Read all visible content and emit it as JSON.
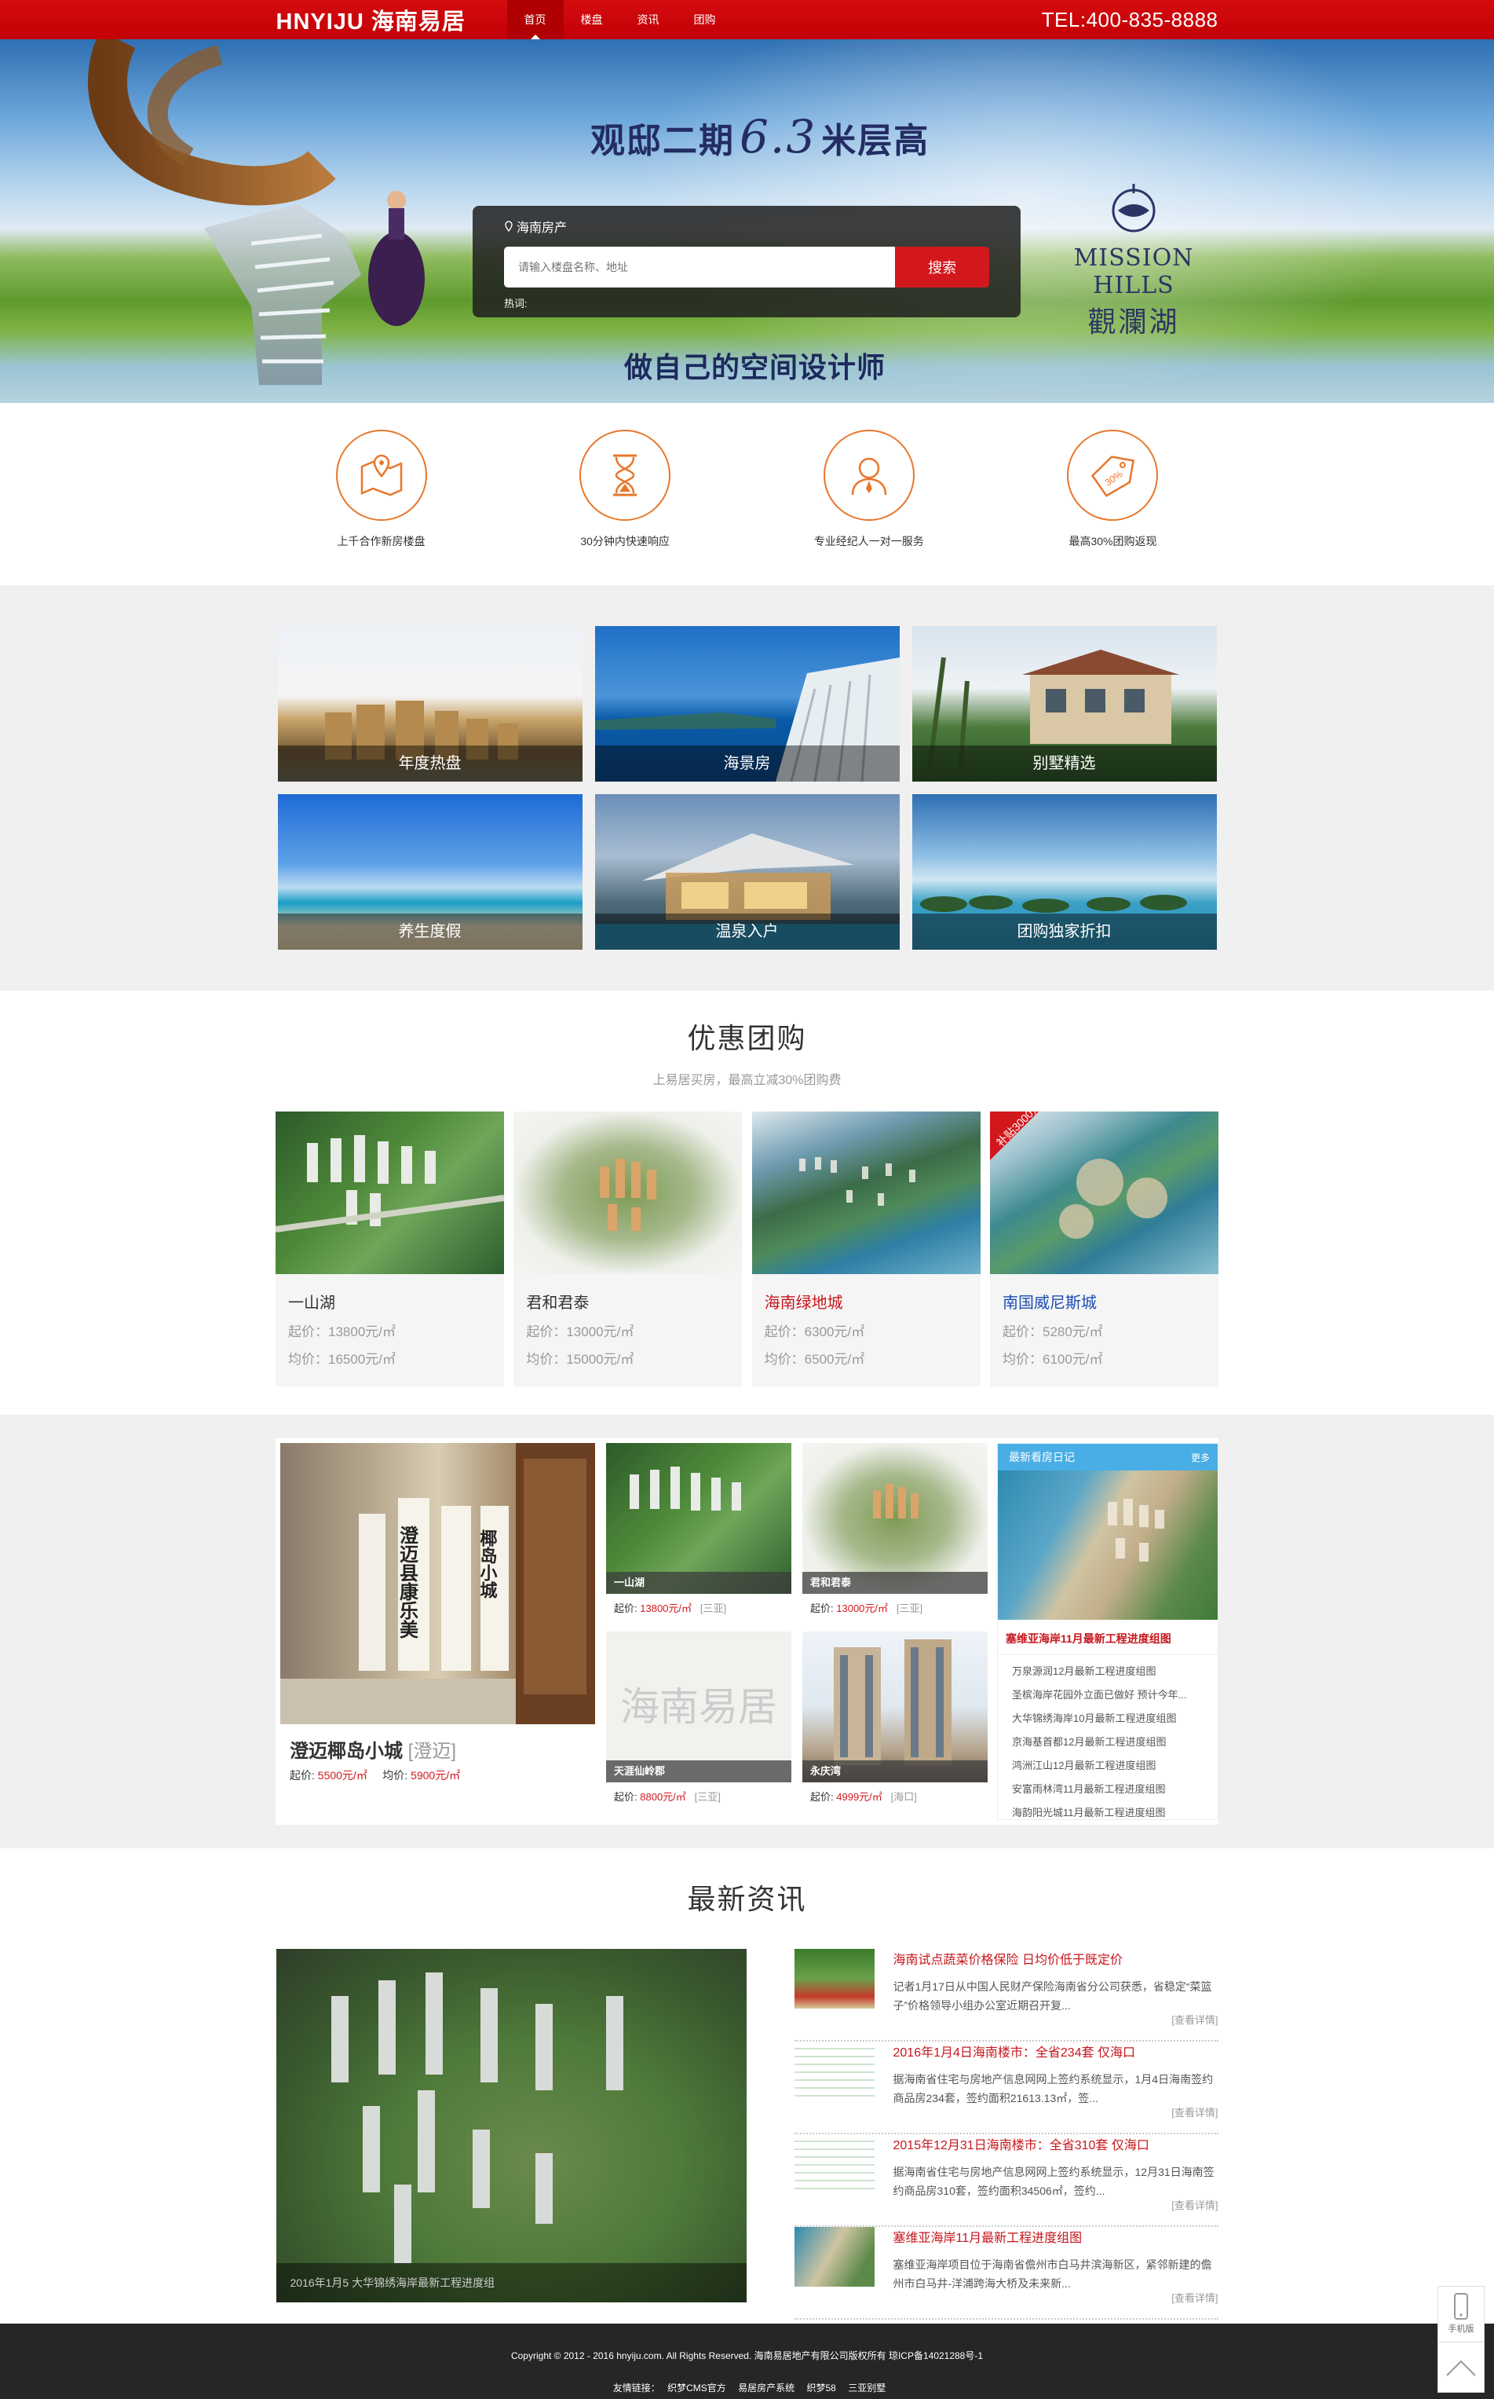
{
  "header": {
    "logo": "HNYIJU 海南易居",
    "nav": [
      {
        "label": "首页",
        "active": true
      },
      {
        "label": "楼盘",
        "active": false
      },
      {
        "label": "资讯",
        "active": false
      },
      {
        "label": "团购",
        "active": false
      }
    ],
    "tel": "TEL:400-835-8888"
  },
  "hero": {
    "title_pre": "观邸二期",
    "title_num": "6.3",
    "title_post": "米层高",
    "slogan": "做自己的空间设计师",
    "brand_en": "MISSION HILLS",
    "brand_cn": "觀瀾湖",
    "search": {
      "location": "海南房产",
      "placeholder": "请输入楼盘名称、地址",
      "button": "搜索",
      "hot_label": "热词:"
    }
  },
  "features": [
    {
      "icon": "map-pin-icon",
      "label": "上千合作新房楼盘"
    },
    {
      "icon": "hourglass-icon",
      "label": "30分钟内快速响应"
    },
    {
      "icon": "agent-icon",
      "label": "专业经纪人一对一服务"
    },
    {
      "icon": "discount-tag-icon",
      "label": "最高30%团购返现"
    }
  ],
  "categories": [
    "年度热盘",
    "海景房",
    "别墅精选",
    "养生度假",
    "温泉入户",
    "团购独家折扣"
  ],
  "group_buy": {
    "title": "优惠团购",
    "subtitle": "上易居买房，最高立减30%团购费",
    "badge": "补贴3000元",
    "cards": [
      {
        "name": "一山湖",
        "start": "起价：13800元/㎡",
        "avg": "均价：16500元/㎡",
        "color": "default"
      },
      {
        "name": "君和君泰",
        "start": "起价：13000元/㎡",
        "avg": "均价：15000元/㎡",
        "color": "default"
      },
      {
        "name": "海南绿地城",
        "start": "起价：6300元/㎡",
        "avg": "均价：6500元/㎡",
        "color": "red"
      },
      {
        "name": "南国威尼斯城",
        "start": "起价：5280元/㎡",
        "avg": "均价：6100元/㎡",
        "color": "blue"
      }
    ]
  },
  "featured": {
    "big": {
      "name": "澄迈椰岛小城",
      "area": "[澄迈]",
      "start_label": "起价:",
      "start": "5500元/㎡",
      "avg_label": "均价:",
      "avg": "5900元/㎡",
      "sign1": "椰岛小城老年大学",
      "sign2": "澄迈县康乐美养老协会"
    },
    "small": [
      {
        "label": "一山湖",
        "price_label": "起价:",
        "price": "13800元/㎡",
        "area": "[三亚]"
      },
      {
        "label": "君和君泰",
        "price_label": "起价:",
        "price": "13000元/㎡",
        "area": "[三亚]"
      },
      {
        "label": "天涯仙岭郡",
        "price_label": "起价:",
        "price": "8800元/㎡",
        "area": "[三亚]",
        "placeholder": "海南易居"
      },
      {
        "label": "永庆湾",
        "price_label": "起价:",
        "price": "4999元/㎡",
        "area": "[海口]"
      }
    ],
    "diary": {
      "title": "最新看房日记",
      "more": "更多",
      "headline": "塞维亚海岸11月最新工程进度组图",
      "items": [
        "万泉源润12月最新工程进度组图",
        "圣槟海岸花园外立面已做好 预计今年...",
        "大华锦绣海岸10月最新工程进度组图",
        "京海基首都12月最新工程进度组图",
        "鸿洲江山12月最新工程进度组图",
        "安富雨林湾11月最新工程进度组图",
        "海韵阳光城11月最新工程进度组图"
      ]
    }
  },
  "news": {
    "title": "最新资讯",
    "big_caption": "2016年1月5 大华锦绣海岸最新工程进度组",
    "items": [
      {
        "title": "海南试点蔬菜价格保险 日均价低于既定价",
        "desc": "记者1月17日从中国人民财产保险海南省分公司获悉，省稳定“菜篮子”价格领导小组办公室近期召开复...",
        "more": "[查看详情]"
      },
      {
        "title": "2016年1月4日海南楼市：全省234套 仅海口",
        "desc": "据海南省住宅与房地产信息网网上签约系统显示，1月4日海南签约商品房234套，签约面积21613.13㎡，签...",
        "more": "[查看详情]"
      },
      {
        "title": "2015年12月31日海南楼市：全省310套 仅海口",
        "desc": "据海南省住宅与房地产信息网网上签约系统显示，12月31日海南签约商品房310套，签约面积34506㎡，签约...",
        "more": "[查看详情]"
      },
      {
        "title": "塞维亚海岸11月最新工程进度组图",
        "desc": "塞维亚海岸项目位于海南省儋州市白马井滨海新区，紧邻新建的儋州市白马井-洋浦跨海大桥及未来新...",
        "more": "[查看详情]"
      }
    ]
  },
  "footer": {
    "copyright": "Copyright © 2012 - 2016 hnyiju.com. All Rights Reserved. 海南易居地产有限公司版权所有 琼ICP备14021288号-1",
    "links_label": "友情链接：",
    "links": [
      "织梦CMS官方",
      "易居房产系统",
      "织梦58",
      "三亚别墅"
    ]
  },
  "float": {
    "mobile": "手机版"
  },
  "colors": {
    "primary_red": "#c7161c",
    "accent_orange": "#e9772b",
    "diary_blue": "#49aee6",
    "footer": "#262626"
  }
}
